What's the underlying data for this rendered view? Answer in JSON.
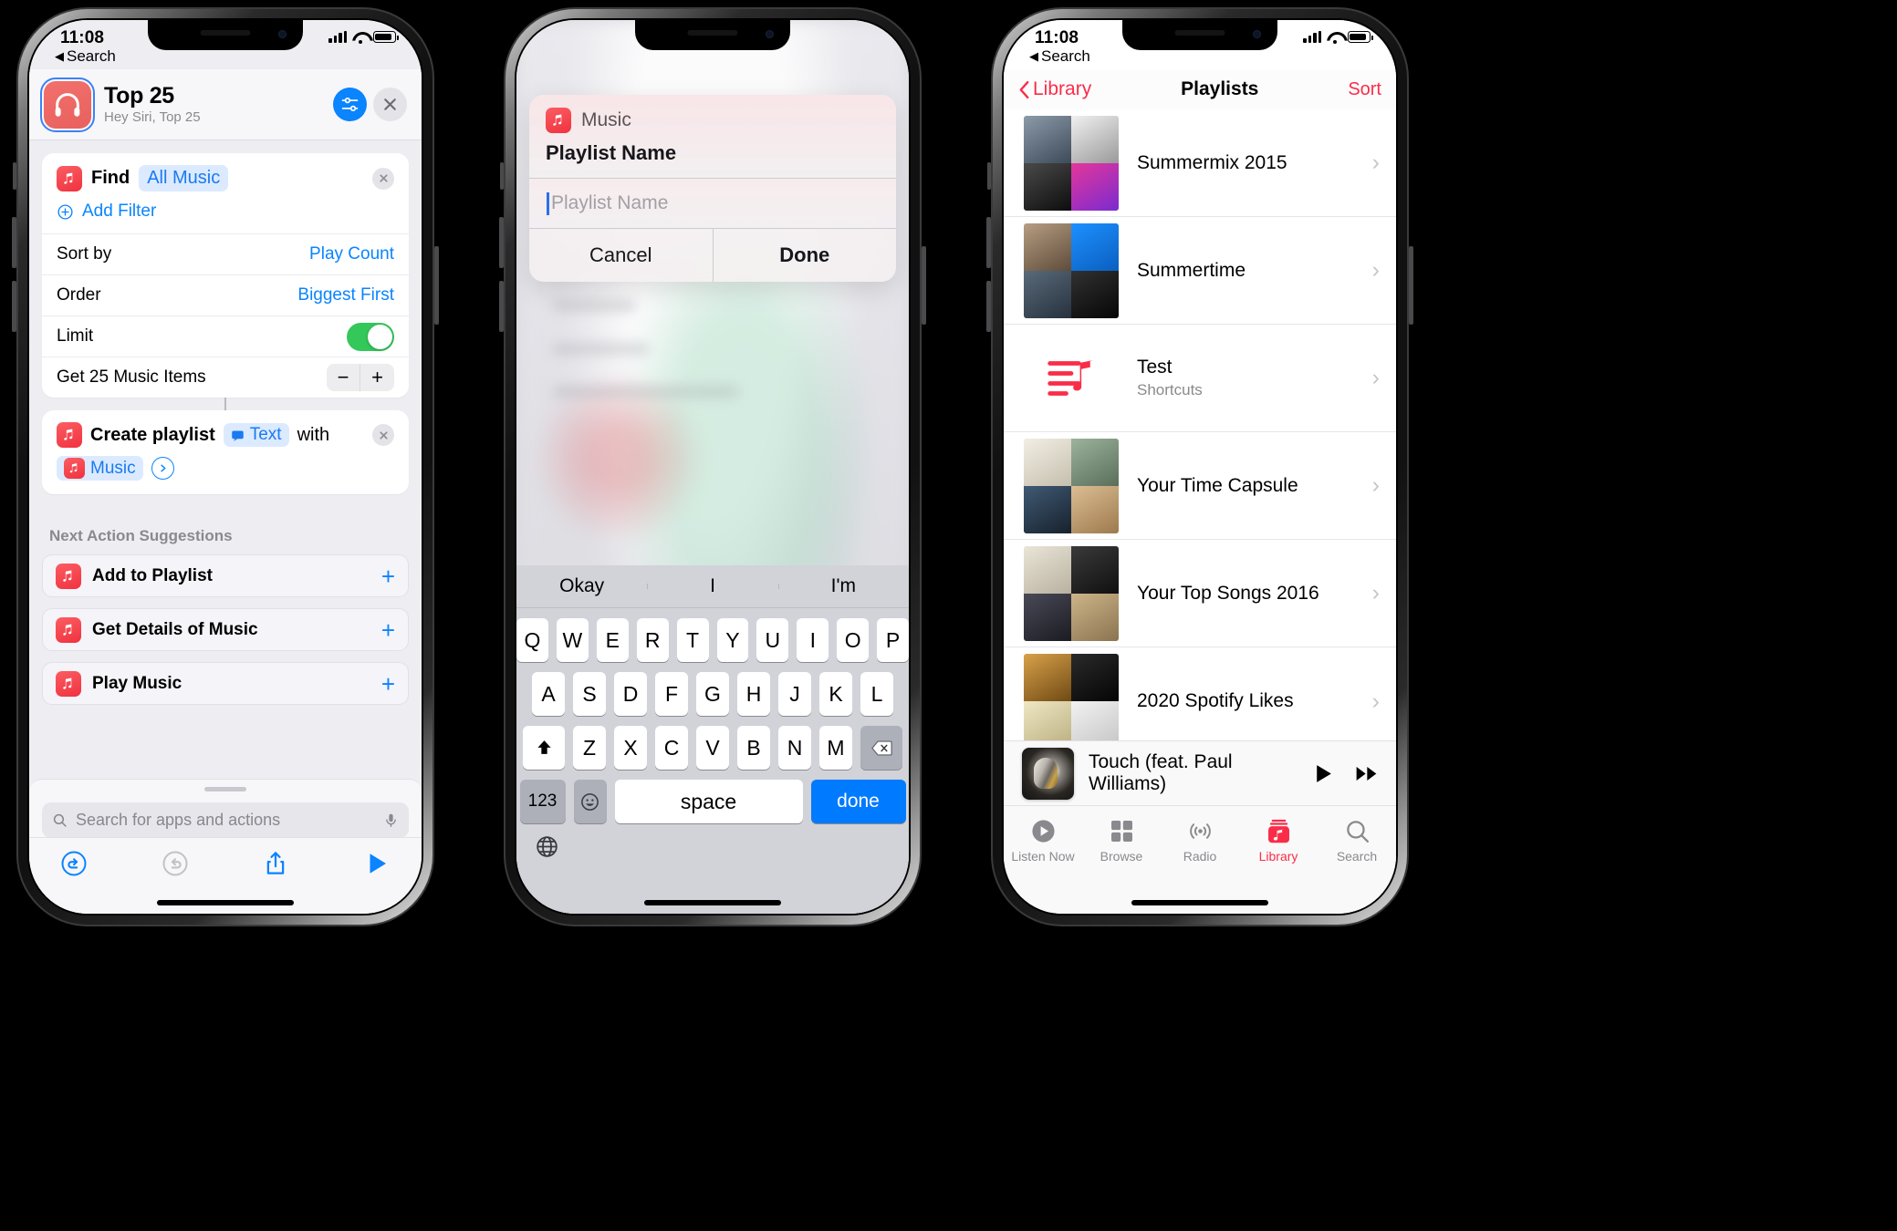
{
  "phone1": {
    "status": {
      "time": "11:08",
      "back_label": "Search"
    },
    "header": {
      "icon": "headphones-icon",
      "title": "Top 25",
      "subtitle": "Hey Siri, Top 25",
      "settings_icon": "sliders-icon",
      "close_icon": "close-icon"
    },
    "find_action": {
      "app_icon": "apple-music-icon",
      "label": "Find",
      "chip": "All Music",
      "remove_icon": "close-circle-icon",
      "add_filter": "Add Filter",
      "properties": [
        {
          "label": "Sort by",
          "value": "Play Count"
        },
        {
          "label": "Order",
          "value": "Biggest First"
        },
        {
          "label": "Limit",
          "value": "on"
        },
        {
          "label": "Get 25 Music Items",
          "value": "stepper"
        }
      ]
    },
    "create_action": {
      "app_icon": "apple-music-icon",
      "label": "Create playlist",
      "chip_text": "Text",
      "connector_word": "with",
      "chip_music": "Music",
      "remove_icon": "close-circle-icon"
    },
    "suggestions_title": "Next Action Suggestions",
    "suggestions": [
      {
        "label": "Add to Playlist",
        "icon": "apple-music-icon",
        "add_icon": "plus-icon"
      },
      {
        "label": "Get Details of Music",
        "icon": "apple-music-icon",
        "add_icon": "plus-icon"
      },
      {
        "label": "Play Music",
        "icon": "apple-music-icon",
        "add_icon": "plus-icon"
      }
    ],
    "search": {
      "placeholder": "Search for apps and actions",
      "icon": "search-icon",
      "mic_icon": "microphone-icon"
    },
    "toolbar": {
      "undo_icon": "undo-icon",
      "redo_icon": "redo-icon",
      "share_icon": "share-icon",
      "play_icon": "play-icon"
    }
  },
  "phone2": {
    "dialog": {
      "app_name": "Music",
      "app_icon": "apple-music-icon",
      "title": "Playlist Name",
      "input_value": "",
      "input_placeholder": "Playlist Name",
      "cancel_label": "Cancel",
      "done_label": "Done"
    },
    "keyboard": {
      "predictions": [
        "Okay",
        "I",
        "I'm"
      ],
      "row1": [
        "Q",
        "W",
        "E",
        "R",
        "T",
        "Y",
        "U",
        "I",
        "O",
        "P"
      ],
      "row2": [
        "A",
        "S",
        "D",
        "F",
        "G",
        "H",
        "J",
        "K",
        "L"
      ],
      "row3": [
        "Z",
        "X",
        "C",
        "V",
        "B",
        "N",
        "M"
      ],
      "shift_icon": "shift-icon",
      "backspace_icon": "backspace-icon",
      "numbers_label": "123",
      "emoji_icon": "emoji-icon",
      "space_label": "space",
      "done_label": "done",
      "globe_icon": "globe-icon"
    }
  },
  "phone3": {
    "status": {
      "time": "11:08",
      "back_label": "Search"
    },
    "nav": {
      "back_label": "Library",
      "title": "Playlists",
      "sort_label": "Sort",
      "back_icon": "chevron-left-icon"
    },
    "playlists": [
      {
        "name": "Summermix 2015",
        "subtitle": "",
        "artwork": "mosaic",
        "chevron": "chevron-right-icon",
        "tiles": [
          "#6c7a8b",
          "#cfcfcf",
          "#1a1a1a",
          "#d6338f"
        ]
      },
      {
        "name": "Summertime",
        "subtitle": "",
        "artwork": "mosaic",
        "chevron": "chevron-right-icon",
        "tiles": [
          "#7c6a5a",
          "#1484f0",
          "#3c4a58",
          "#0f0f0f"
        ]
      },
      {
        "name": "Test",
        "subtitle": "Shortcuts",
        "artwork": "shortcuts-playlist-icon",
        "chevron": "chevron-right-icon",
        "tiles": []
      },
      {
        "name": "Your Time Capsule",
        "subtitle": "",
        "artwork": "mosaic",
        "chevron": "chevron-right-icon",
        "tiles": [
          "#e8e4dc",
          "#7c8f7e",
          "#2c3e50",
          "#c9a77c"
        ]
      },
      {
        "name": "Your Top Songs 2016",
        "subtitle": "",
        "artwork": "mosaic",
        "chevron": "chevron-right-icon",
        "tiles": [
          "#d8d3c8",
          "#1c1c1c",
          "#2b2b33",
          "#b5a07a"
        ]
      },
      {
        "name": "2020 Spotify Likes",
        "subtitle": "",
        "artwork": "mosaic",
        "chevron": "chevron-right-icon",
        "tiles": [
          "#9a6b2f",
          "#141414",
          "#d8cfa8",
          "#e6e6e6"
        ]
      }
    ],
    "now_playing": {
      "title": "Touch (feat. Paul Williams)",
      "play_icon": "play-icon",
      "next_icon": "fast-forward-icon"
    },
    "tabs": [
      {
        "label": "Listen Now",
        "icon": "listen-now-icon",
        "active": false
      },
      {
        "label": "Browse",
        "icon": "browse-grid-icon",
        "active": false
      },
      {
        "label": "Radio",
        "icon": "radio-waves-icon",
        "active": false
      },
      {
        "label": "Library",
        "icon": "library-icon",
        "active": true
      },
      {
        "label": "Search",
        "icon": "search-icon",
        "active": false
      }
    ]
  },
  "colors": {
    "music_red": "#fa2d48",
    "ios_blue": "#0a84ff",
    "switch_green": "#34c759",
    "chip_blue_bg": "#dceaff"
  }
}
